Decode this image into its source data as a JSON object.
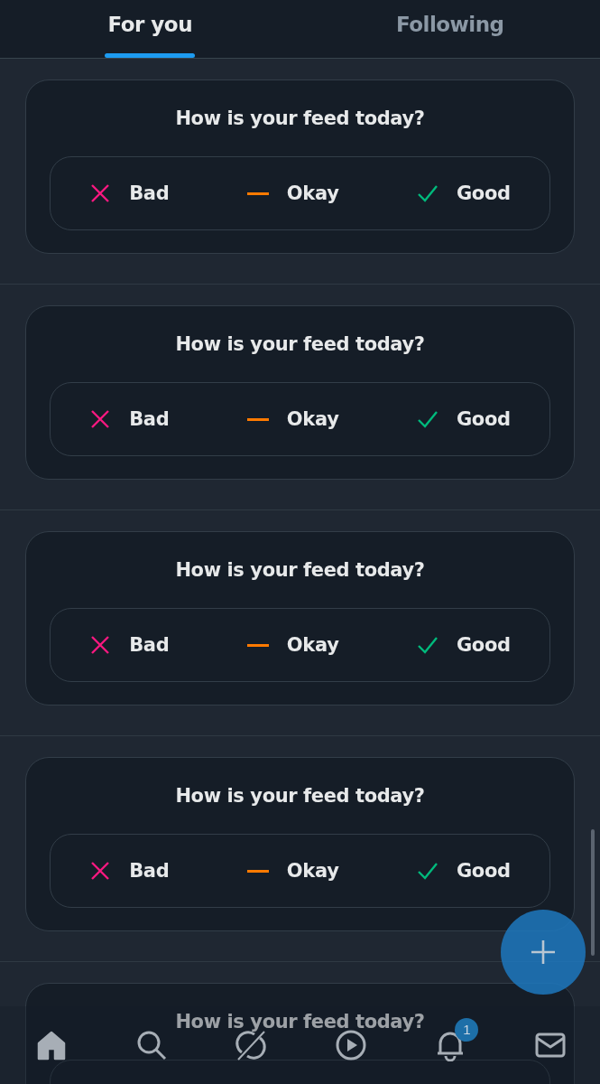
{
  "tabs": [
    {
      "label": "For you",
      "selected": true
    },
    {
      "label": "Following",
      "selected": false
    }
  ],
  "feed": [
    {
      "title": "How is your feed today?",
      "options": [
        {
          "label": "Bad",
          "kind": "bad"
        },
        {
          "label": "Okay",
          "kind": "okay"
        },
        {
          "label": "Good",
          "kind": "good"
        }
      ]
    },
    {
      "title": "How is your feed today?",
      "options": [
        {
          "label": "Bad",
          "kind": "bad"
        },
        {
          "label": "Okay",
          "kind": "okay"
        },
        {
          "label": "Good",
          "kind": "good"
        }
      ]
    },
    {
      "title": "How is your feed today?",
      "options": [
        {
          "label": "Bad",
          "kind": "bad"
        },
        {
          "label": "Okay",
          "kind": "okay"
        },
        {
          "label": "Good",
          "kind": "good"
        }
      ]
    },
    {
      "title": "How is your feed today?",
      "options": [
        {
          "label": "Bad",
          "kind": "bad"
        },
        {
          "label": "Okay",
          "kind": "okay"
        },
        {
          "label": "Good",
          "kind": "good"
        }
      ]
    },
    {
      "title": "How is your feed today?"
    }
  ],
  "bottom_nav": [
    {
      "kind": "home",
      "selected": true
    },
    {
      "kind": "search",
      "selected": false
    },
    {
      "kind": "grok",
      "selected": false
    },
    {
      "kind": "video",
      "selected": false
    },
    {
      "kind": "notifications",
      "selected": false,
      "badge": "1"
    },
    {
      "kind": "messages",
      "selected": false
    }
  ]
}
